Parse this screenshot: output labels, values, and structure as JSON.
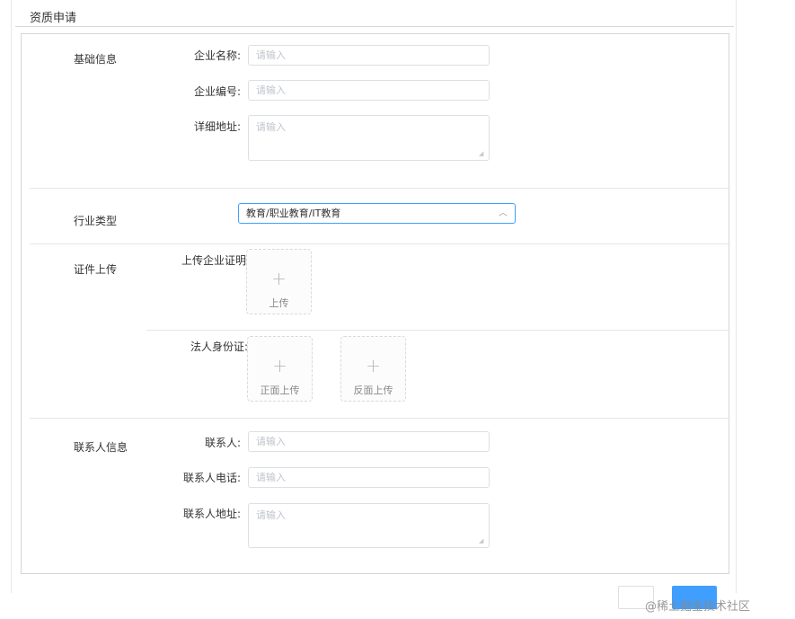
{
  "page_title": "资质申请",
  "sections": {
    "basic": {
      "label": "基础信息",
      "company_name": {
        "label": "企业名称:",
        "placeholder": "请输入"
      },
      "company_code": {
        "label": "企业编号:",
        "placeholder": "请输入"
      },
      "address": {
        "label": "详细地址:",
        "placeholder": "请输入"
      }
    },
    "industry": {
      "label": "行业类型",
      "value": "教育/职业教育/IT教育"
    },
    "certificate": {
      "label": "证件上传",
      "company_proof": {
        "label": "上传企业证明:",
        "upload_text": "上传"
      },
      "legal_id": {
        "label": "法人身份证:",
        "front_text": "正面上传",
        "back_text": "反面上传"
      }
    },
    "contact": {
      "label": "联系人信息",
      "person": {
        "label": "联系人:",
        "placeholder": "请输入"
      },
      "phone": {
        "label": "联系人电话:",
        "placeholder": "请输入"
      },
      "address": {
        "label": "联系人地址:",
        "placeholder": "请输入"
      }
    }
  },
  "watermark": "@稀土掘金技术社区",
  "icons": {
    "plus": "plus-icon",
    "chevron": "chevron-up-icon",
    "grip": "resize-grip-icon"
  }
}
